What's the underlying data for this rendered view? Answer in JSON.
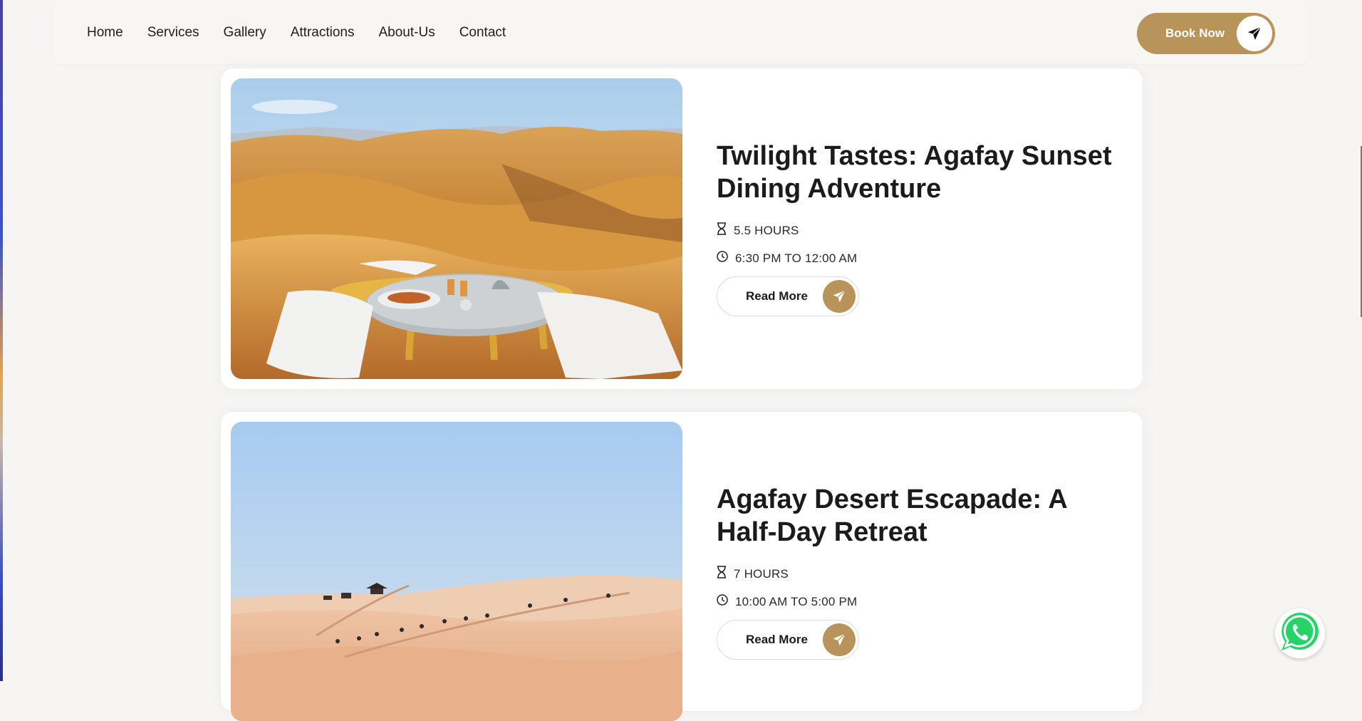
{
  "nav": {
    "links": [
      "Home",
      "Services",
      "Gallery",
      "Attractions",
      "About-Us",
      "Contact"
    ],
    "book_label": "Book Now"
  },
  "tours": [
    {
      "title": "Twilight Tastes: Agafay Sunset Dining Adventure",
      "duration": "5.5 HOURS",
      "time": "6:30 PM TO 12:00 AM",
      "cta": "Read More"
    },
    {
      "title": "Agafay Desert Escapade: A Half-Day Retreat",
      "duration": "7 HOURS",
      "time": "10:00 AM TO 5:00 PM",
      "cta": "Read More"
    }
  ],
  "icons": {
    "duration": "hourglass-icon",
    "time": "clock-icon",
    "cta": "paper-plane-icon",
    "chat": "whatsapp-icon"
  },
  "colors": {
    "accent": "#b8935a",
    "whatsapp": "#25d366"
  }
}
